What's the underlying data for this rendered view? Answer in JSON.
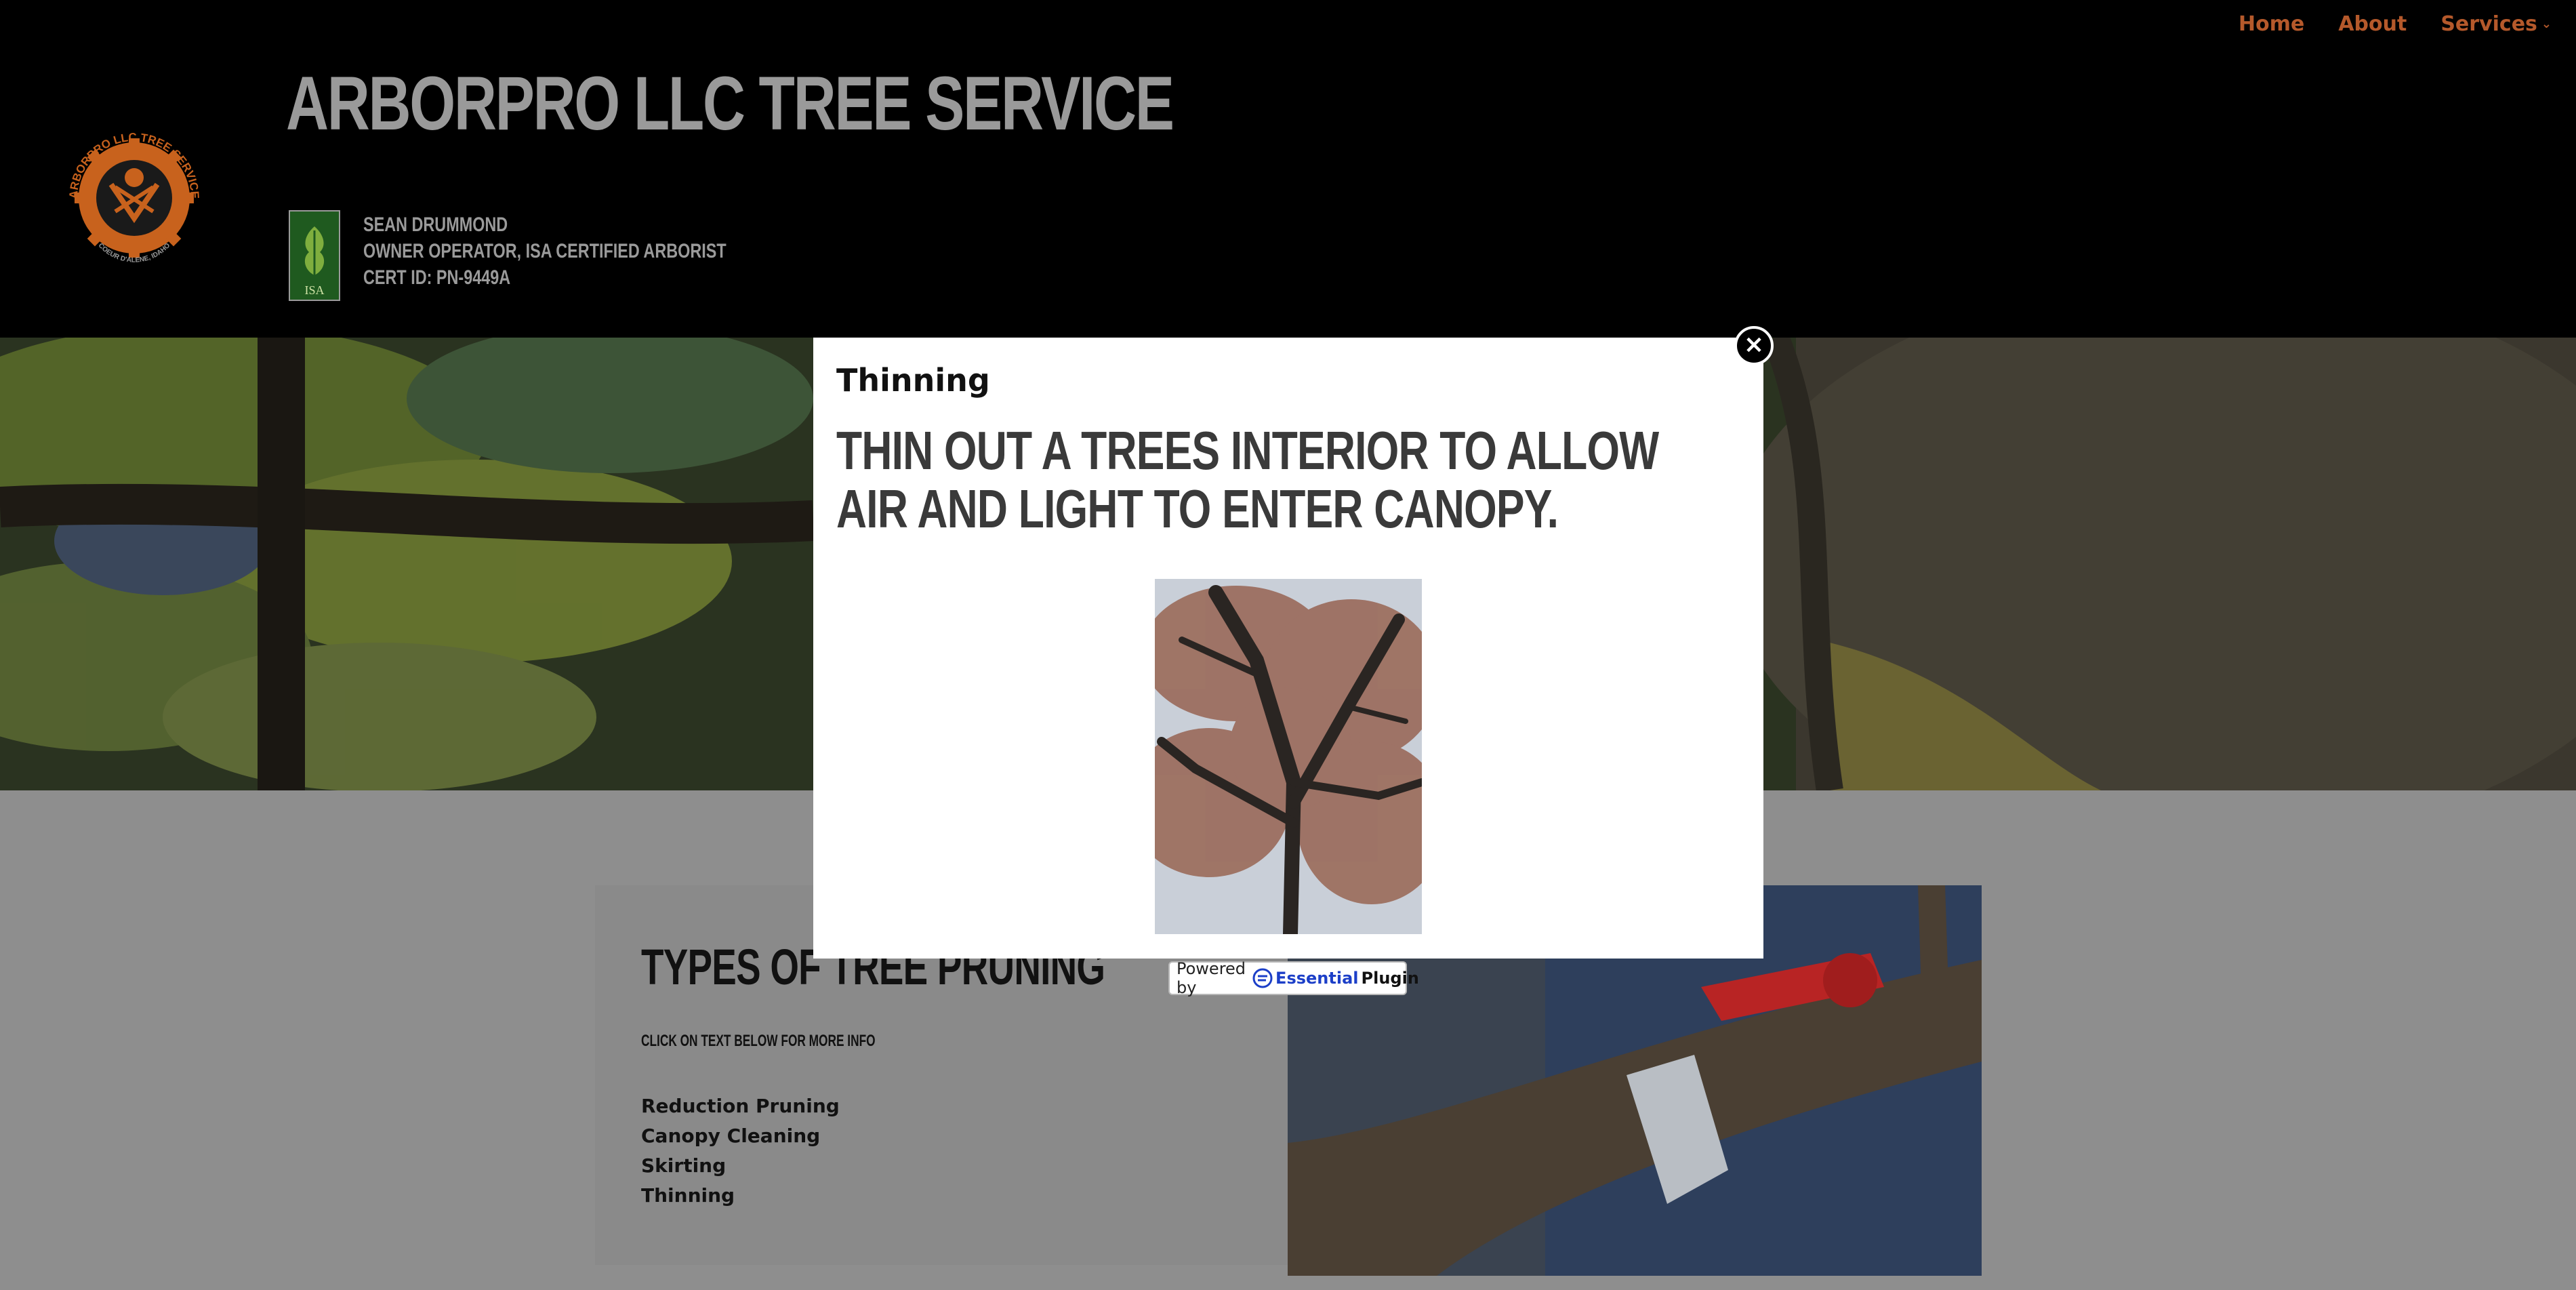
{
  "nav": {
    "home": "Home",
    "about": "About",
    "services": "Services",
    "services_chevron": "⌄"
  },
  "header": {
    "site_title": "ARBORPRO LLC TREE SERVICE",
    "logo_text": "ARBORPRO LLC TREE SERVICE",
    "logo_subtext": "COEUR D'ALENE, IDAHO",
    "isa_badge_text": "ISA",
    "owner_lines": [
      "SEAN DRUMMOND",
      "OWNER OPERATOR, ISA CERTIFIED ARBORIST",
      "CERT ID: PN-9449A"
    ]
  },
  "content": {
    "title": "TYPES OF TREE PRUNING",
    "subtitle": "CLICK ON TEXT BELOW FOR MORE INFO",
    "items": [
      "Reduction Pruning",
      "Canopy Cleaning",
      "Skirting",
      "Thinning"
    ]
  },
  "modal": {
    "heading": "Thinning",
    "description": "THIN OUT A TREES INTERIOR TO ALLOW AIR AND LIGHT TO ENTER CANOPY.",
    "close_icon": "close-icon",
    "close_glyph": "✕"
  },
  "powered": {
    "label": "Powered by",
    "brand_a": "Essential",
    "brand_b": "Plugin"
  },
  "colors": {
    "header_bg": "#000000",
    "nav_link": "#b5592b",
    "title_gray": "#9a9a9a",
    "page_bg": "#8e8e8e",
    "logo_orange": "#c8621d",
    "brand_blue": "#1c3fc8"
  }
}
